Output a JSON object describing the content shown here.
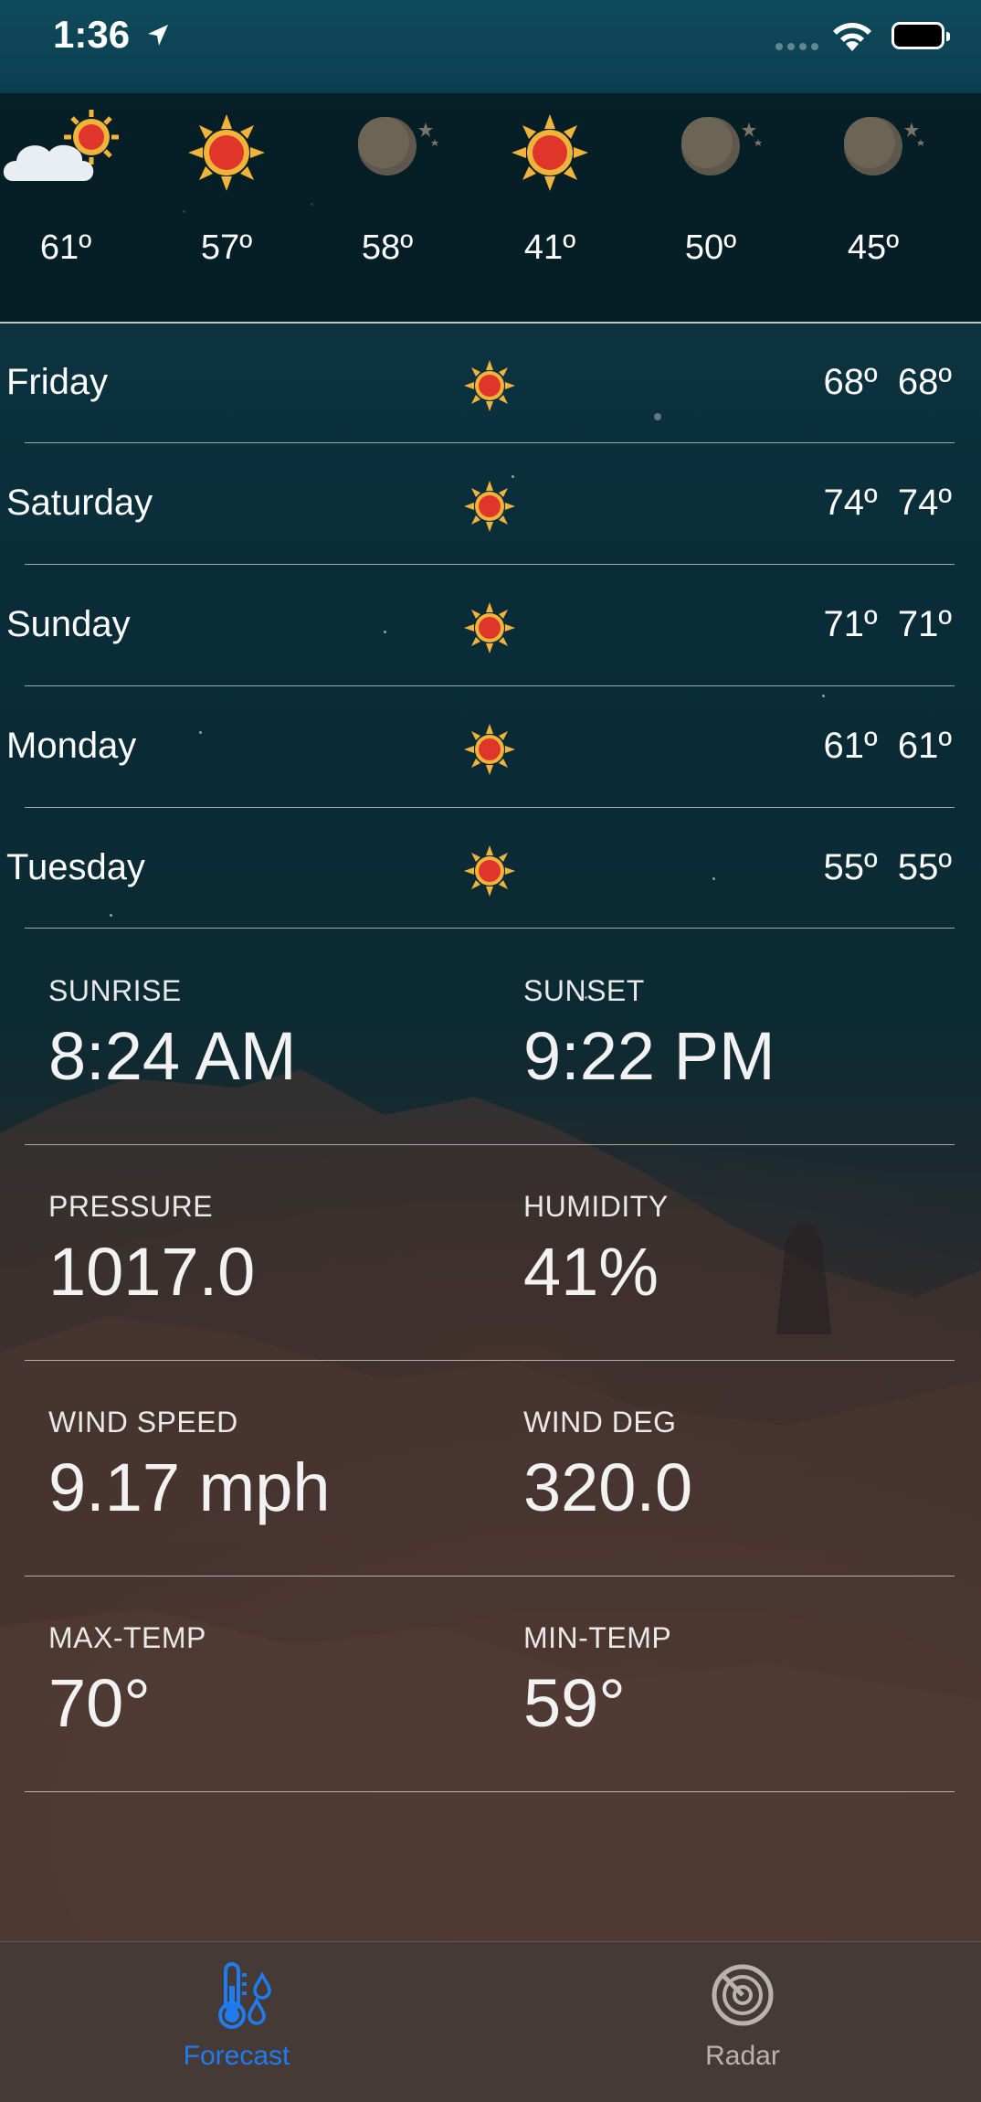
{
  "status_bar": {
    "time": "1:36",
    "icons": [
      "location-arrow-icon",
      "signal-icon",
      "wifi-icon",
      "battery-icon"
    ]
  },
  "hourly": [
    {
      "icon": "partly-cloudy-day-icon",
      "temp": "61º"
    },
    {
      "icon": "sun-icon",
      "temp": "57º"
    },
    {
      "icon": "moon-icon",
      "temp": "58º"
    },
    {
      "icon": "sun-icon",
      "temp": "41º"
    },
    {
      "icon": "moon-icon",
      "temp": "50º"
    },
    {
      "icon": "moon-icon",
      "temp": "45º"
    }
  ],
  "daily": [
    {
      "day": "Friday",
      "icon": "sun-icon",
      "high": "68º",
      "low": "68º"
    },
    {
      "day": "Saturday",
      "icon": "sun-icon",
      "high": "74º",
      "low": "74º"
    },
    {
      "day": "Sunday",
      "icon": "sun-icon",
      "high": "71º",
      "low": "71º"
    },
    {
      "day": "Monday",
      "icon": "sun-icon",
      "high": "61º",
      "low": "61º"
    },
    {
      "day": "Tuesday",
      "icon": "sun-icon",
      "high": "55º",
      "low": "55º"
    }
  ],
  "details": {
    "sunrise": {
      "label": "SUNRISE",
      "value": "8:24 AM"
    },
    "sunset": {
      "label": "SUNSET",
      "value": "9:22 PM"
    },
    "pressure": {
      "label": "PRESSURE",
      "value": "1017.0"
    },
    "humidity": {
      "label": "HUMIDITY",
      "value": "41%"
    },
    "wind_speed": {
      "label": "WIND SPEED",
      "value": "9.17 mph"
    },
    "wind_deg": {
      "label": "WIND DEG",
      "value": "320.0"
    },
    "max_temp": {
      "label": "MAX-TEMP",
      "value": "70°"
    },
    "min_temp": {
      "label": "MIN-TEMP",
      "value": "59°"
    }
  },
  "tab_bar": {
    "tabs": [
      {
        "label": "Forecast",
        "icon": "thermometer-rain-icon",
        "selected": true
      },
      {
        "label": "Radar",
        "icon": "radar-icon",
        "selected": false
      }
    ]
  },
  "colors": {
    "accent": "#1e7cf0",
    "tab_inactive": "#b9b3b0",
    "sky_top": "#0e3b4a",
    "rock": "#3c2d2b"
  }
}
